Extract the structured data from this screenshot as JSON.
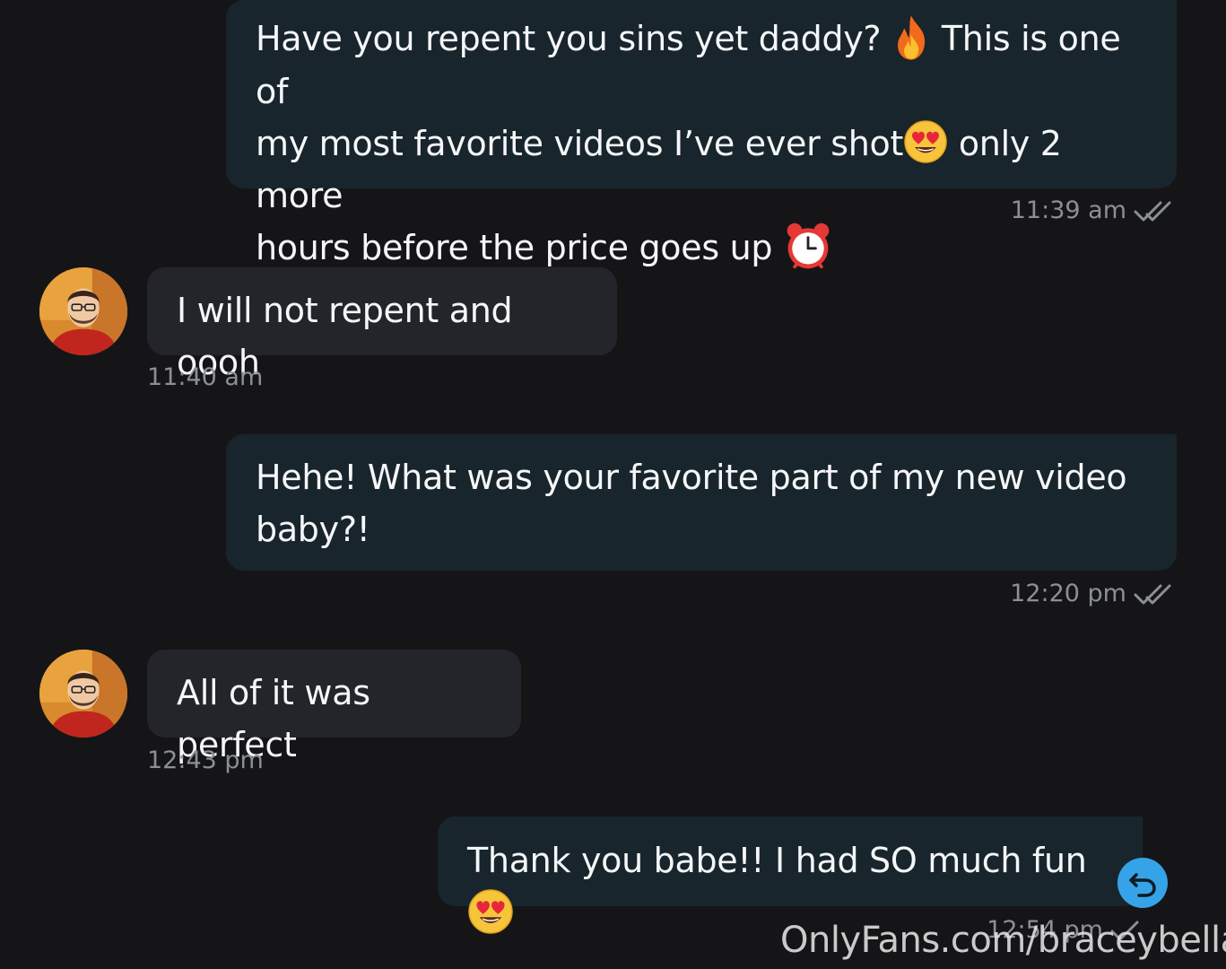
{
  "colors": {
    "background": "#151518",
    "outgoing_bubble": "#19252c",
    "incoming_bubble": "#24252a",
    "timestamp": "#8b9096",
    "reply_button": "#36a3e8"
  },
  "messages": [
    {
      "direction": "outgoing",
      "lines": [
        {
          "text_a": "Have you repent you sins yet daddy?",
          "emoji": "fire-emoji",
          "text_b": "This is one of"
        },
        {
          "text_a": "my most favorite videos I’ve ever shot",
          "emoji": "heart-eyes-emoji",
          "text_b": "only 2 more"
        },
        {
          "text_a": "hours before the price goes up",
          "emoji": "alarm-clock-emoji",
          "text_b": ""
        }
      ],
      "time": "11:39 am",
      "status_icon": "double-check-icon"
    },
    {
      "direction": "incoming",
      "text": "I will not repent and oooh",
      "time": "11:40 am",
      "avatar": "user-avatar"
    },
    {
      "direction": "outgoing",
      "lines": [
        {
          "text": "Hehe! What was your favorite part of my new video"
        },
        {
          "text": "baby?!"
        }
      ],
      "time": "12:20 pm",
      "status_icon": "double-check-icon"
    },
    {
      "direction": "incoming",
      "text": "All of it was perfect",
      "time": "12:43 pm",
      "avatar": "user-avatar"
    },
    {
      "direction": "outgoing",
      "text": "Thank you babe!! I had SO much fun",
      "emoji": "heart-eyes-emoji",
      "time": "12:54 pm",
      "status_icon": "single-check-icon"
    }
  ],
  "reply_button_icon": "undo-arrow-icon",
  "watermark": "OnlyFans.com/braceybella"
}
